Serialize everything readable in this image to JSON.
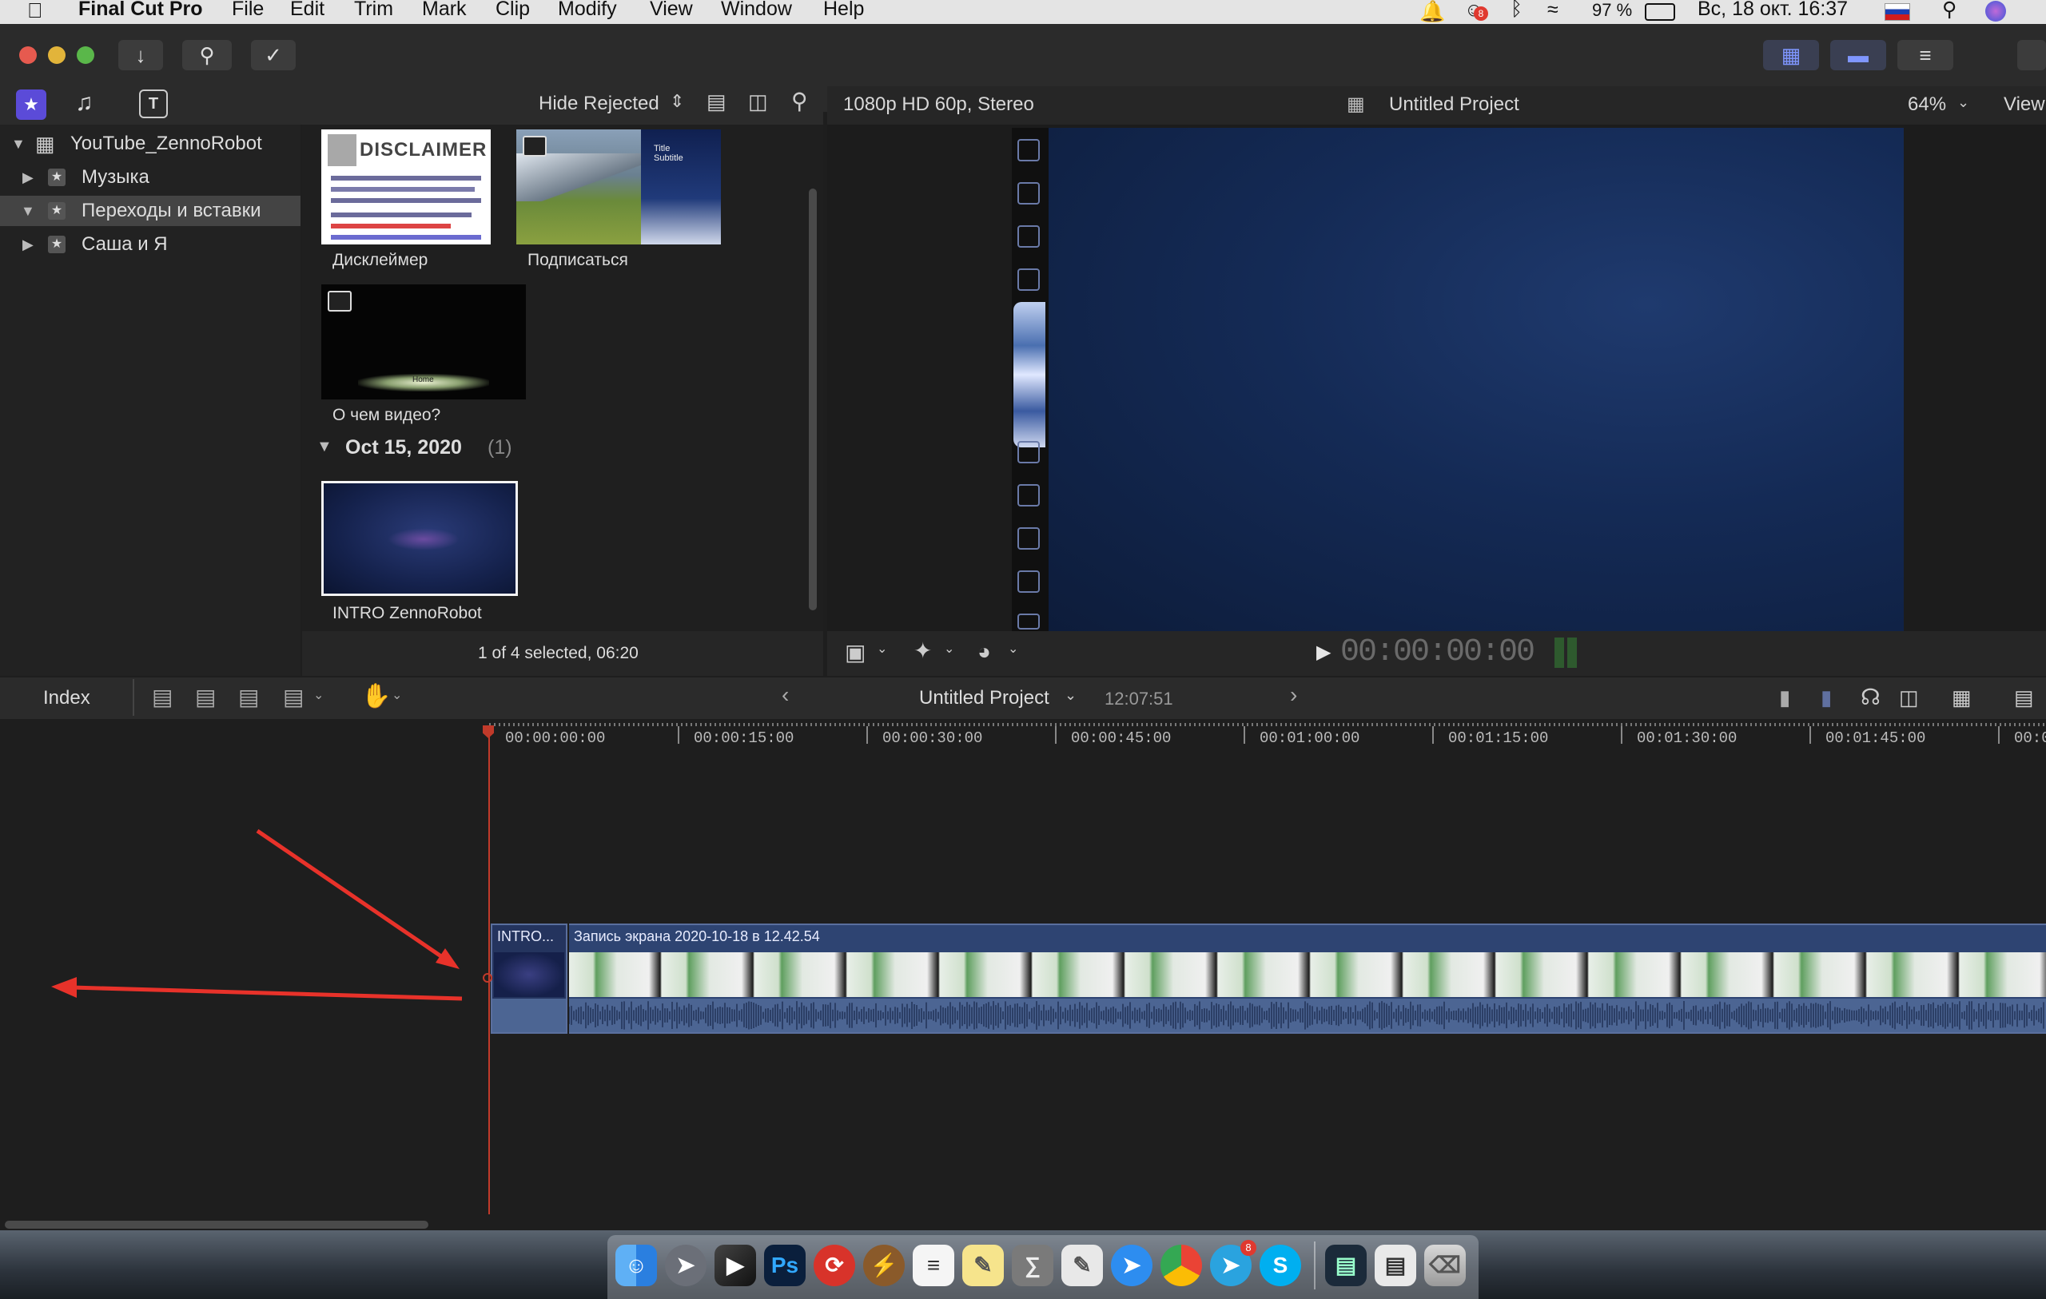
{
  "menubar": {
    "app_name": "Final Cut Pro",
    "menus": [
      "File",
      "Edit",
      "Trim",
      "Mark",
      "Clip",
      "Modify",
      "View",
      "Window",
      "Help"
    ],
    "notification_badge": "8",
    "battery": "97 %",
    "datetime": "Вс, 18 окт. 16:37"
  },
  "browser_toolbar": {
    "filter_label": "Hide Rejected"
  },
  "library": {
    "name": "YouTube_ZennoRobot",
    "events": [
      {
        "label": "Музыка",
        "expanded": false,
        "selected": false
      },
      {
        "label": "Переходы и вставки",
        "expanded": true,
        "selected": true
      },
      {
        "label": "Саша и Я",
        "expanded": false,
        "selected": false
      }
    ]
  },
  "browser": {
    "clips": [
      {
        "label": "Дисклеймер",
        "thumb_text": "DISCLAIMER"
      },
      {
        "label": "Подписаться",
        "thumb_text": "Title Subtitle"
      },
      {
        "label": "О чем видео?",
        "thumb_text": "Home"
      }
    ],
    "date_group": {
      "label": "Oct 15, 2020",
      "count": "(1)"
    },
    "group_clips": [
      {
        "label": "INTRO ZennoRobot"
      }
    ],
    "footer_status": "1 of 4 selected, 06:20"
  },
  "viewer": {
    "format": "1080p HD 60p, Stereo",
    "project_title": "Untitled Project",
    "zoom": "64%",
    "view_label": "View",
    "timecode": "00:00:00:00"
  },
  "timeline_bar": {
    "index_label": "Index",
    "project_title": "Untitled Project",
    "duration": "12:07:51"
  },
  "ruler": {
    "labels": [
      "00:00:00:00",
      "00:00:15:00",
      "00:00:30:00",
      "00:00:45:00",
      "00:01:00:00",
      "00:01:15:00",
      "00:01:30:00",
      "00:01:45:00",
      "00:0"
    ]
  },
  "timeline_clips": {
    "intro": {
      "label": "INTRO..."
    },
    "main": {
      "label": "Запись экрана 2020-10-18 в 12.42.54"
    }
  },
  "colors": {
    "annotation_arrow": "#e8322a",
    "playhead": "#c13a2a",
    "selected_tab": "#4a5cc9"
  },
  "dock": {
    "telegram_badge": "8",
    "photoshop_label": "Ps",
    "skype_label": "S"
  }
}
